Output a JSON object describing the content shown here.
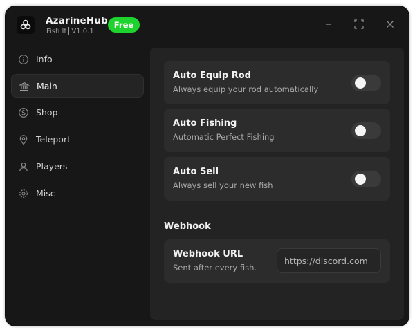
{
  "app": {
    "name": "AzarineHub",
    "game": "Fish It",
    "version": "V1.0.1",
    "badge": "Free",
    "accent_color": "#1fd32e"
  },
  "window_controls": [
    "minimize-icon",
    "maximize-icon",
    "close-icon"
  ],
  "sidebar": {
    "items": [
      {
        "label": "Info",
        "icon": "info-icon",
        "active": false
      },
      {
        "label": "Main",
        "icon": "bank-icon",
        "active": true
      },
      {
        "label": "Shop",
        "icon": "dollar-icon",
        "active": false
      },
      {
        "label": "Teleport",
        "icon": "map-pin-icon",
        "active": false
      },
      {
        "label": "Players",
        "icon": "user-icon",
        "active": false
      },
      {
        "label": "Misc",
        "icon": "gear-icon",
        "active": false
      }
    ]
  },
  "main": {
    "toggles": [
      {
        "title": "Auto Equip Rod",
        "desc": "Always equip your rod automatically",
        "on": false
      },
      {
        "title": "Auto Fishing",
        "desc": "Automatic Perfect Fishing",
        "on": false
      },
      {
        "title": "Auto Sell",
        "desc": "Always sell your new fish",
        "on": false
      }
    ],
    "webhook_section": "Webhook",
    "webhook": {
      "title": "Webhook URL",
      "desc": "Sent after every fish.",
      "placeholder": "https://discord.com"
    }
  }
}
